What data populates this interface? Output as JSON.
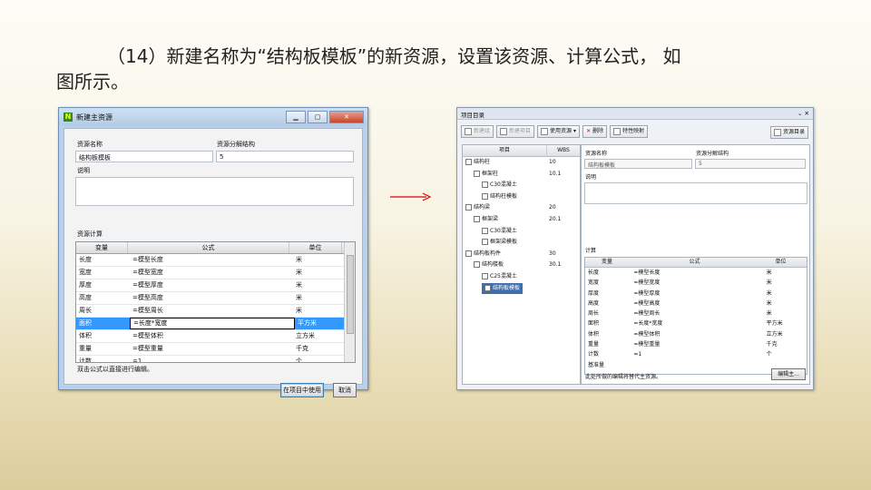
{
  "slide": {
    "title_line1": "（14）新建名称为“结构板模板”的新资源，设置该资源、计算公式， 如",
    "title_line2": "图所示。"
  },
  "dialog": {
    "title": "新建主资源",
    "resource_name_label": "资源名称",
    "resource_name_value": "结构板模板",
    "wbs_label": "资源分解结构",
    "wbs_value": "5",
    "desc_label": "说明",
    "calc_label": "资源计算",
    "col_var": "变量",
    "col_formula": "公式",
    "col_unit": "单位",
    "rows": [
      {
        "var": "长度",
        "formula": "=模型长度",
        "unit": "米"
      },
      {
        "var": "宽度",
        "formula": "=模型宽度",
        "unit": "米"
      },
      {
        "var": "厚度",
        "formula": "=模型厚度",
        "unit": "米"
      },
      {
        "var": "高度",
        "formula": "=模型高度",
        "unit": "米"
      },
      {
        "var": "周长",
        "formula": "=模型周长",
        "unit": "米"
      },
      {
        "var": "面积",
        "formula": "=长度*宽度",
        "unit": "平方米"
      },
      {
        "var": "体积",
        "formula": "=模型体积",
        "unit": "立方米"
      },
      {
        "var": "重量",
        "formula": "=模型重量",
        "unit": "千克"
      },
      {
        "var": "计数",
        "formula": "=1",
        "unit": "个"
      }
    ],
    "hint": "双击公式以直接进行编辑。",
    "use_button": "在项目中使用",
    "cancel_button": "取消"
  },
  "panel": {
    "title": "项目目录",
    "pin": "⌄ ✕",
    "toolbar": {
      "new_build": "新建组",
      "new_item": "新建项目",
      "use_resource": "使用资源",
      "delete": "删除",
      "map": "特性映射",
      "catalog": "资源目录"
    },
    "tree_col_item": "项目",
    "tree_col_wbs": "WBS",
    "tree": [
      {
        "name": "结构柱",
        "wbs": "10",
        "lvl": 0
      },
      {
        "name": "框架柱",
        "wbs": "10.1",
        "lvl": 1
      },
      {
        "name": "C30混凝土",
        "wbs": "",
        "lvl": 2
      },
      {
        "name": "结构柱模板",
        "wbs": "",
        "lvl": 2
      },
      {
        "name": "结构梁",
        "wbs": "20",
        "lvl": 0
      },
      {
        "name": "框架梁",
        "wbs": "20.1",
        "lvl": 1
      },
      {
        "name": "C30混凝土",
        "wbs": "",
        "lvl": 2
      },
      {
        "name": "框架梁模板",
        "wbs": "",
        "lvl": 2
      },
      {
        "name": "结构板构件",
        "wbs": "30",
        "lvl": 0
      },
      {
        "name": "结构楼板",
        "wbs": "30.1",
        "lvl": 1
      },
      {
        "name": "C25混凝土",
        "wbs": "",
        "lvl": 2
      },
      {
        "name": "结构板模板",
        "wbs": "",
        "lvl": 2
      }
    ],
    "resource_name_label": "资源名称",
    "resource_name_value": "结构板模板",
    "wbs_label": "资源分解结构",
    "wbs_value": "5",
    "desc_label": "说明",
    "calc_label": "计算",
    "col_var": "变量",
    "col_formula": "公式",
    "col_unit": "单位",
    "rows": [
      {
        "var": "长度",
        "formula": "=模型长度",
        "unit": "米"
      },
      {
        "var": "宽度",
        "formula": "=模型宽度",
        "unit": "米"
      },
      {
        "var": "厚度",
        "formula": "=模型厚度",
        "unit": "米"
      },
      {
        "var": "高度",
        "formula": "=模型高度",
        "unit": "米"
      },
      {
        "var": "周长",
        "formula": "=模型周长",
        "unit": "米"
      },
      {
        "var": "面积",
        "formula": "=长度*宽度",
        "unit": "平方米"
      },
      {
        "var": "体积",
        "formula": "=模型体积",
        "unit": "立方米"
      },
      {
        "var": "重量",
        "formula": "=模型重量",
        "unit": "千克"
      },
      {
        "var": "计数",
        "formula": "=1",
        "unit": "个"
      },
      {
        "var": "基准量",
        "formula": "",
        "unit": ""
      }
    ],
    "footer": "此处所做的编辑将替代主资源。",
    "edit_button": "编辑主..."
  }
}
